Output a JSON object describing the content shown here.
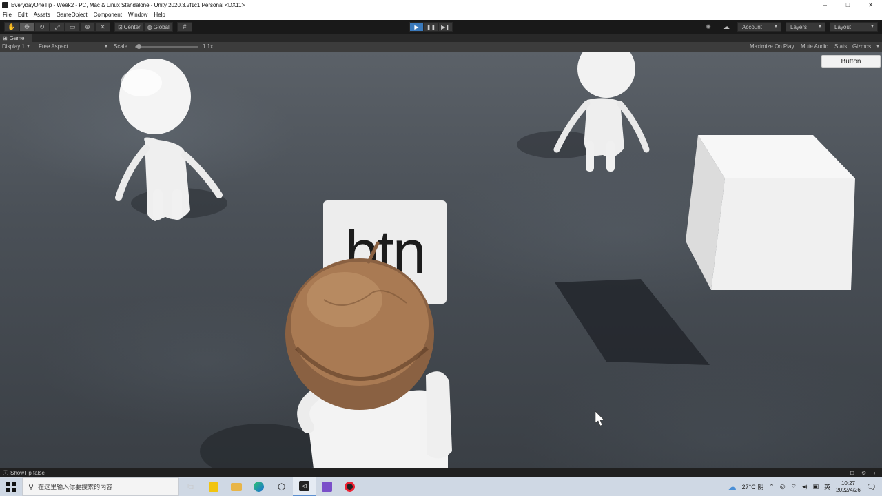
{
  "window": {
    "title": "EverydayOneTip - Week2 - PC, Mac & Linux Standalone - Unity 2020.3.2f1c1 Personal <DX11>",
    "minimize": "–",
    "maximize": "□",
    "close": "✕"
  },
  "menu": [
    "File",
    "Edit",
    "Assets",
    "GameObject",
    "Component",
    "Window",
    "Help"
  ],
  "toolbar": {
    "center_label": "Center",
    "global_label": "Global",
    "account_label": "Account",
    "layers_label": "Layers",
    "layout_label": "Layout",
    "play_active": true
  },
  "game_view": {
    "tab_label": "Game",
    "display": "Display 1",
    "aspect": "Free Aspect",
    "scale_label": "Scale",
    "scale_value": "1.1x",
    "scale_level": 0.05,
    "maximize_on_play": "Maximize On Play",
    "mute_audio": "Mute Audio",
    "stats": "Stats",
    "gizmos": "Gizmos"
  },
  "scene": {
    "ui_button_label": "Button",
    "world_button_text": "btn"
  },
  "status": {
    "message": "ShowTip false"
  },
  "taskbar": {
    "search_placeholder": "在这里输入你要搜索的内容",
    "weather": "27°C 阴",
    "lang": "英",
    "time": "10:27",
    "date": "2022/4/26"
  },
  "colors": {
    "play_blue": "#3a79bb",
    "unity_dark": "#191919",
    "panel": "#3c3c3c"
  }
}
